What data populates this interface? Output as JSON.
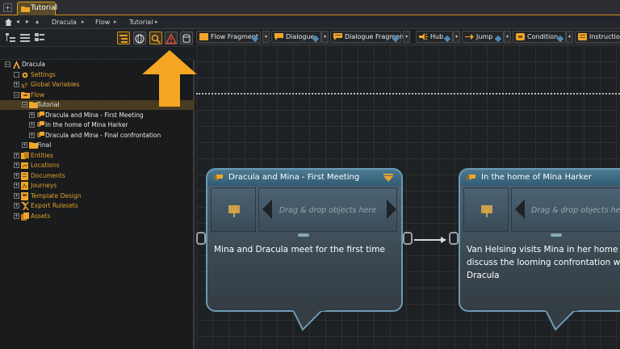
{
  "window": {
    "tab_title": "Tutorial"
  },
  "breadcrumb": {
    "items": [
      "Dracula",
      "Flow",
      "Tutorial"
    ]
  },
  "tree": {
    "root": "Dracula",
    "items": [
      {
        "label": "Settings"
      },
      {
        "label": "Global Variables"
      },
      {
        "label": "Flow"
      },
      {
        "label": "Tutorial"
      },
      {
        "label": "Dracula and Mina - First Meeting"
      },
      {
        "label": "In the home of Mina Harker"
      },
      {
        "label": "Dracula and Mina - Final confrontation"
      },
      {
        "label": "Final"
      },
      {
        "label": "Entities"
      },
      {
        "label": "Locations"
      },
      {
        "label": "Documents"
      },
      {
        "label": "Journeys"
      },
      {
        "label": "Template Design"
      },
      {
        "label": "Export Rulesets"
      },
      {
        "label": "Assets"
      }
    ]
  },
  "node_toolbar": {
    "items": [
      "Flow Fragment",
      "Dialogue",
      "Dialogue Fragment",
      "Hub",
      "Jump",
      "Condition",
      "Instruction"
    ]
  },
  "cards": [
    {
      "title": "Dracula and Mina - First Meeting",
      "drop_hint": "Drag & drop objects here",
      "text": "Mina and Dracula meet for the first time"
    },
    {
      "title": "In the home of Mina Harker",
      "drop_hint": "Drag & drop objects here",
      "text_lines": [
        "Van Helsing visits Mina in her home",
        "discuss the looming confrontation w",
        "Dracula"
      ]
    }
  ],
  "colors": {
    "accent": "#e39a22",
    "card_header": "#3d6a84",
    "selection": "#4a3c20"
  }
}
